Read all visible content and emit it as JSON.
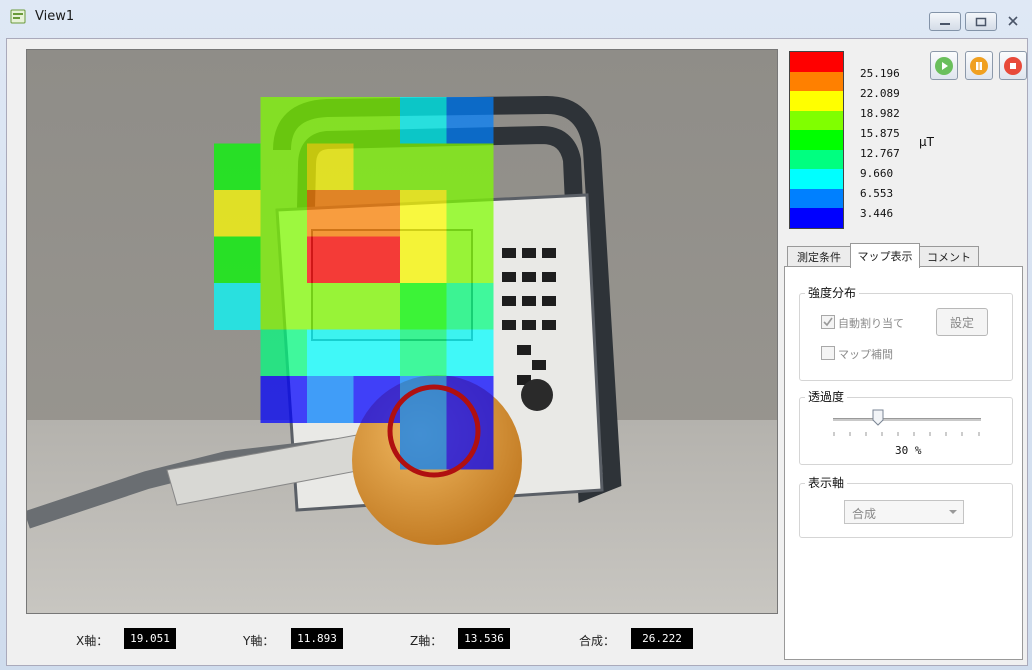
{
  "window": {
    "title": "View1"
  },
  "legend": {
    "colors": [
      "#ff0000",
      "#ff8000",
      "#ffff00",
      "#80ff00",
      "#00ff00",
      "#00ff80",
      "#00ffff",
      "#0080ff",
      "#0000ff"
    ],
    "values": [
      "25.196",
      "22.089",
      "18.982",
      "15.875",
      "12.767",
      "9.660",
      "6.553",
      "3.446"
    ],
    "unit": "μT"
  },
  "controls": {
    "play_icon": "play-icon",
    "pause_icon": "pause-icon",
    "stop_icon": "stop-icon",
    "play_color": "#6abf5c",
    "pause_color": "#f0a020",
    "stop_color": "#e84a3a"
  },
  "tabs": [
    "測定条件",
    "マップ表示",
    "コメント"
  ],
  "active_tab": 1,
  "intensity": {
    "title": "強度分布",
    "auto_assign_label": "自動割り当て",
    "auto_assign_checked": true,
    "map_interp_label": "マップ補間",
    "map_interp_checked": false,
    "settings_button": "設定"
  },
  "transparency": {
    "title": "透過度",
    "value": 30,
    "value_text": "30 %"
  },
  "display_axis": {
    "title": "表示軸",
    "selected": "合成"
  },
  "readouts": [
    {
      "label": "X軸：",
      "value": "19.051"
    },
    {
      "label": "Y軸：",
      "value": "11.893"
    },
    {
      "label": "Z軸：",
      "value": "13.536"
    },
    {
      "label": "合成：",
      "value": "26.222"
    }
  ],
  "heatmap": {
    "rows": [
      [
        null,
        "#80ff00",
        "#80ff00",
        "#80ff00",
        "#00ffff",
        "#0080ff"
      ],
      [
        "#00ff00",
        "#80ff00",
        "#ffff00",
        "#80ff00",
        "#80ff00",
        "#80ff00"
      ],
      [
        "#ffff00",
        "#80ff00",
        "#ff8000",
        "#ff8000",
        "#ffff00",
        "#80ff00"
      ],
      [
        "#00ff00",
        "#80ff00",
        "#ff0000",
        "#ff0000",
        "#ffff00",
        "#80ff00"
      ],
      [
        "#00ffff",
        "#80ff00",
        "#80ff00",
        "#80ff00",
        "#00ff00",
        "#00ff80"
      ],
      [
        null,
        "#00ff80",
        "#00ffff",
        "#00ffff",
        "#00ff80",
        "#00ffff"
      ],
      [
        null,
        "#0000ff",
        "#0080ff",
        "#0000ff",
        "#0080ff",
        "#0000ff"
      ],
      [
        null,
        null,
        null,
        null,
        "#0080ff",
        "#0000ff"
      ]
    ]
  }
}
